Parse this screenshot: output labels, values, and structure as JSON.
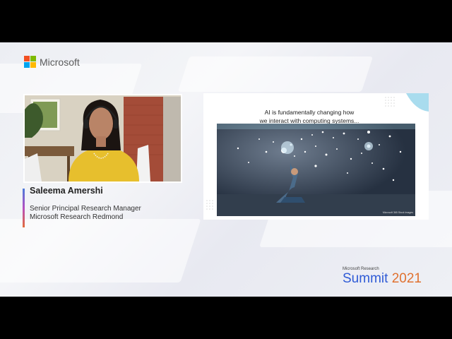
{
  "brand": {
    "logo_text": "Microsoft",
    "colors": {
      "red": "#f25022",
      "green": "#7fba00",
      "blue": "#00a4ef",
      "yellow": "#ffb900"
    }
  },
  "speaker": {
    "name": "Saleema Amershi",
    "title": "Senior Principal Research Manager",
    "org": "Microsoft Research Redmond"
  },
  "slide": {
    "title_line1": "AI is fundamentally changing how",
    "title_line2": "we interact with computing systems...",
    "image_credit": "Microsoft 365 Stock Images"
  },
  "event": {
    "kicker": "Microsoft Research",
    "name": "Summit",
    "year": "2021",
    "name_color": "#2f5bd6",
    "year_color": "#e0712f"
  }
}
